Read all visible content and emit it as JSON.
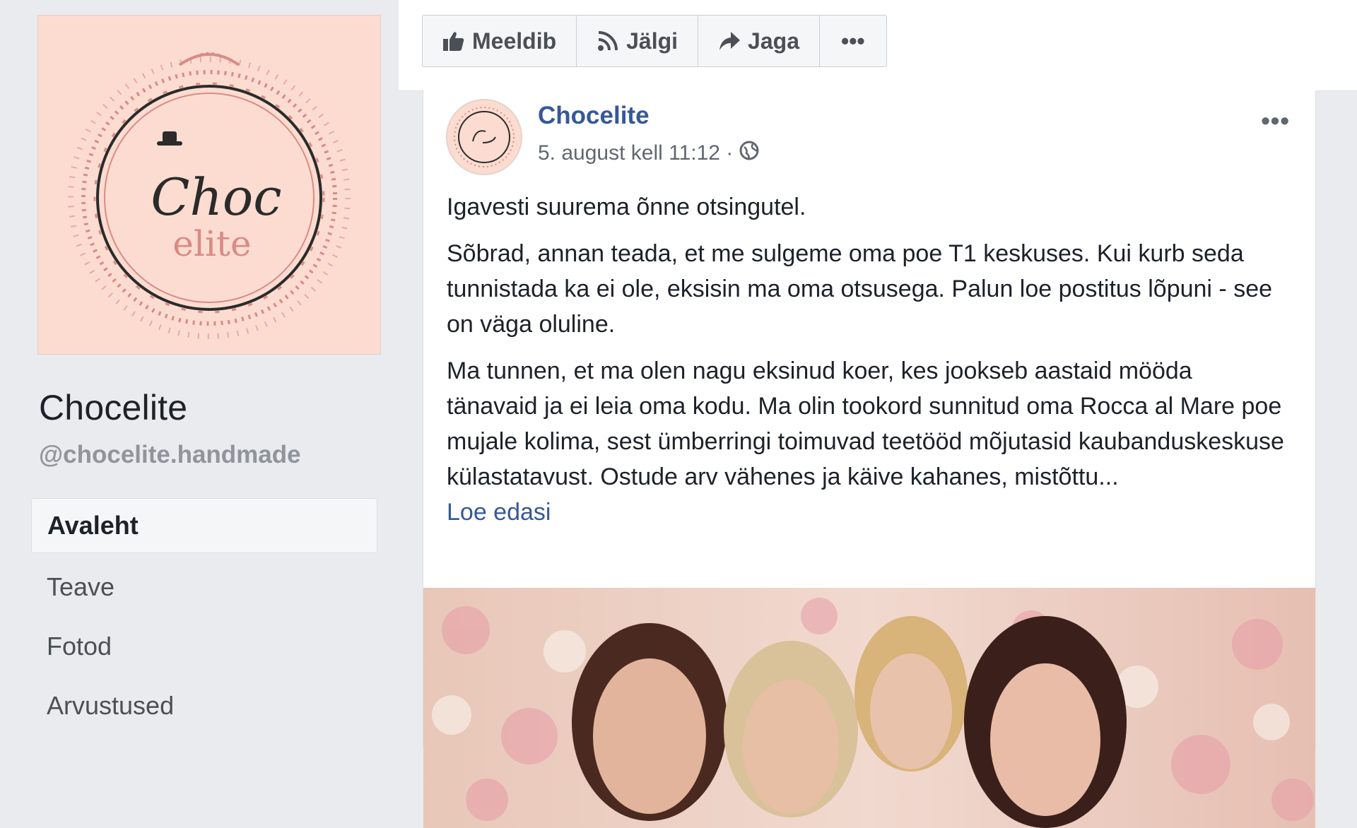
{
  "sidebar": {
    "page_name": "Chocelite",
    "handle": "@chocelite.handmade",
    "logo_text_top": "Choc",
    "logo_text_bottom": "elite",
    "nav": [
      {
        "label": "Avaleht",
        "active": true
      },
      {
        "label": "Teave",
        "active": false
      },
      {
        "label": "Fotod",
        "active": false
      },
      {
        "label": "Arvustused",
        "active": false
      }
    ]
  },
  "actions": {
    "like_label": "Meeldib",
    "follow_label": "Jälgi",
    "share_label": "Jaga",
    "more_label": "•••"
  },
  "post": {
    "author": "Chocelite",
    "timestamp": "5. august kell 11:12 ·",
    "more_label": "•••",
    "paragraphs": [
      "Igavesti suurema õnne otsingutel.",
      "Sõbrad, annan teada, et me sulgeme oma poe T1 keskuses. Kui kurb seda tunnistada ka ei ole, eksisin ma oma otsusega. Palun loe postitus lõpuni - see on väga oluline.",
      "Ma tunnen, et ma olen nagu eksinud koer, kes jookseb aastaid mööda tänavaid ja ei leia oma kodu. Ma olin tookord sunnitud oma Rocca al Mare poe mujale kolima, sest ümberringi toimuvad teetööd mõjutasid kaubanduskeskuse külastatavust. Ostude arv vähenes ja käive kahanes, mistõttu..."
    ],
    "read_more": "Loe edasi"
  },
  "colors": {
    "link": "#365899",
    "logo_bg": "#fcdcd0",
    "logo_ring": "#2b2b2b",
    "logo_rose": "#d98b85"
  }
}
